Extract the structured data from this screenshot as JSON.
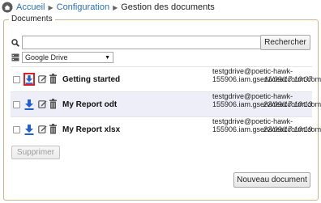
{
  "breadcrumb": {
    "home": "Accueil",
    "configuration": "Configuration",
    "current": "Gestion des documents"
  },
  "documents_panel": {
    "legend": "Documents",
    "search": {
      "value": "",
      "placeholder": ""
    },
    "search_button": "Rechercher",
    "storage_select": "Google Drive",
    "rows": [
      {
        "name": "Getting started",
        "owner": "testgdrive@poetic-hawk-155906.iam.gserviceaccount.com",
        "date": "11/09/17 10:37",
        "download_focused": true
      },
      {
        "name": "My Report odt",
        "owner": "testgdrive@poetic-hawk-155906.iam.gserviceaccount.com",
        "date": "22/09/17 10:13",
        "download_focused": false
      },
      {
        "name": "My Report xlsx",
        "owner": "testgdrive@poetic-hawk-155906.iam.gserviceaccount.com",
        "date": "22/09/17 10:19",
        "download_focused": false
      }
    ],
    "delete_button": "Supprimer",
    "new_button": "Nouveau document"
  },
  "colors": {
    "link": "#2e6fb7",
    "download_icon": "#1f5fd0",
    "focus_outline": "#e02020",
    "fieldset_border": "#d0b18a"
  },
  "icons": [
    "home-icon",
    "search-icon",
    "storage-icon",
    "download-icon",
    "edit-icon",
    "trash-icon"
  ]
}
